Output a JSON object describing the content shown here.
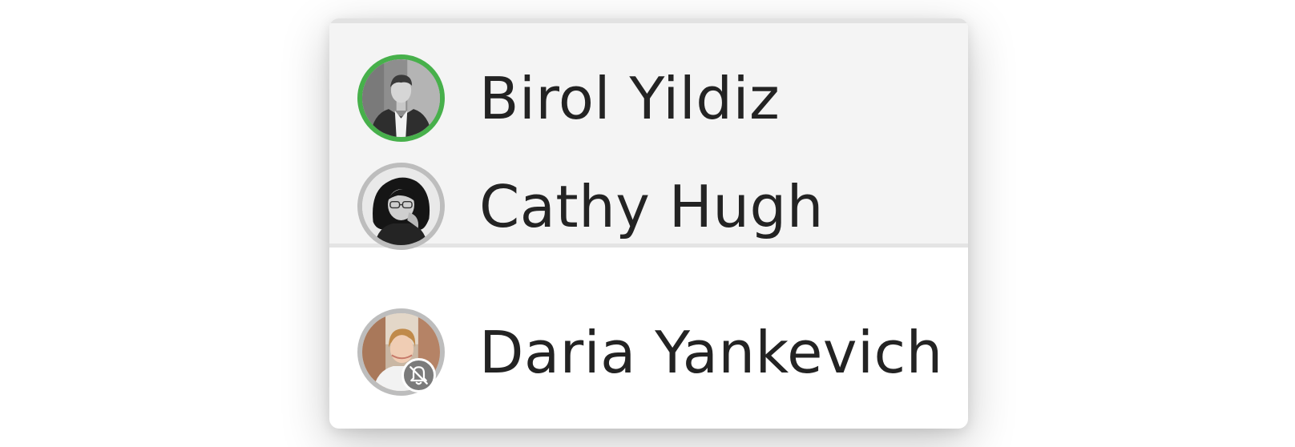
{
  "contacts": {
    "active_group": [
      {
        "name": "Birol Yildiz",
        "status": "online",
        "ring_color": "#47b04b",
        "avatar_icon": "man-photo-avatar"
      },
      {
        "name": "Cathy Hugh",
        "status": "offline",
        "ring_color": "#bdbdbd",
        "avatar_icon": "woman-glasses-photo-avatar"
      }
    ],
    "other_group": [
      {
        "name": "Daria Yankevich",
        "status": "offline",
        "ring_color": "#bdbdbd",
        "avatar_icon": "woman-photo-avatar",
        "badge_icon": "bell-off-icon",
        "muted": true
      }
    ]
  },
  "colors": {
    "active_group_bg": "#f4f4f4",
    "panel_bg": "#ffffff",
    "divider": "#e4e4e4",
    "text": "#232323",
    "badge_bg": "#7b7b7b"
  }
}
